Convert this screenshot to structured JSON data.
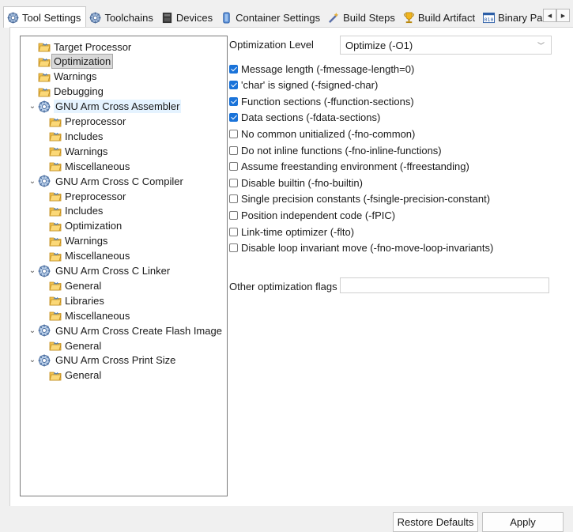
{
  "tabs": [
    {
      "label": "Tool Settings",
      "icon": "gear-icon",
      "active": true
    },
    {
      "label": "Toolchains",
      "icon": "gear-icon",
      "active": false
    },
    {
      "label": "Devices",
      "icon": "chip-icon",
      "active": false
    },
    {
      "label": "Container Settings",
      "icon": "container-icon",
      "active": false
    },
    {
      "label": "Build Steps",
      "icon": "wand-icon",
      "active": false
    },
    {
      "label": "Build Artifact",
      "icon": "trophy-icon",
      "active": false
    },
    {
      "label": "Binary Parsers",
      "icon": "binary-icon",
      "active": false
    }
  ],
  "tree": [
    {
      "label": "Target Processor",
      "level": 1,
      "kind": "folder"
    },
    {
      "label": "Optimization",
      "level": 1,
      "kind": "folder",
      "selected": true
    },
    {
      "label": "Warnings",
      "level": 1,
      "kind": "folder"
    },
    {
      "label": "Debugging",
      "level": 1,
      "kind": "folder"
    },
    {
      "label": "GNU Arm Cross Assembler",
      "level": 0,
      "kind": "tool",
      "expanded": true,
      "hover": true
    },
    {
      "label": "Preprocessor",
      "level": 2,
      "kind": "folder"
    },
    {
      "label": "Includes",
      "level": 2,
      "kind": "folder"
    },
    {
      "label": "Warnings",
      "level": 2,
      "kind": "folder"
    },
    {
      "label": "Miscellaneous",
      "level": 2,
      "kind": "folder"
    },
    {
      "label": "GNU Arm Cross C Compiler",
      "level": 0,
      "kind": "tool",
      "expanded": true
    },
    {
      "label": "Preprocessor",
      "level": 2,
      "kind": "folder"
    },
    {
      "label": "Includes",
      "level": 2,
      "kind": "folder"
    },
    {
      "label": "Optimization",
      "level": 2,
      "kind": "folder"
    },
    {
      "label": "Warnings",
      "level": 2,
      "kind": "folder"
    },
    {
      "label": "Miscellaneous",
      "level": 2,
      "kind": "folder"
    },
    {
      "label": "GNU Arm Cross C Linker",
      "level": 0,
      "kind": "tool",
      "expanded": true
    },
    {
      "label": "General",
      "level": 2,
      "kind": "folder"
    },
    {
      "label": "Libraries",
      "level": 2,
      "kind": "folder"
    },
    {
      "label": "Miscellaneous",
      "level": 2,
      "kind": "folder"
    },
    {
      "label": "GNU Arm Cross Create Flash Image",
      "level": 0,
      "kind": "tool",
      "expanded": true
    },
    {
      "label": "General",
      "level": 2,
      "kind": "folder"
    },
    {
      "label": "GNU Arm Cross Print Size",
      "level": 0,
      "kind": "tool",
      "expanded": true
    },
    {
      "label": "General",
      "level": 2,
      "kind": "folder"
    }
  ],
  "optimization": {
    "level_label": "Optimization Level",
    "level_value": "Optimize (-O1)",
    "options": [
      {
        "label": "Message length (-fmessage-length=0)",
        "checked": true
      },
      {
        "label": "'char' is signed (-fsigned-char)",
        "checked": true
      },
      {
        "label": "Function sections (-ffunction-sections)",
        "checked": true
      },
      {
        "label": "Data sections (-fdata-sections)",
        "checked": true
      },
      {
        "label": "No common unitialized (-fno-common)",
        "checked": false
      },
      {
        "label": "Do not inline functions (-fno-inline-functions)",
        "checked": false
      },
      {
        "label": "Assume freestanding environment (-ffreestanding)",
        "checked": false
      },
      {
        "label": "Disable builtin (-fno-builtin)",
        "checked": false
      },
      {
        "label": "Single precision constants (-fsingle-precision-constant)",
        "checked": false
      },
      {
        "label": "Position independent code (-fPIC)",
        "checked": false
      },
      {
        "label": "Link-time optimizer (-flto)",
        "checked": false
      },
      {
        "label": "Disable loop invariant move (-fno-move-loop-invariants)",
        "checked": false
      }
    ],
    "other_label": "Other optimization flags",
    "other_value": ""
  },
  "buttons": {
    "restore": "Restore Defaults",
    "apply": "Apply"
  },
  "colors": {
    "accent": "#1a73d9",
    "selection": "#d9d9d9",
    "hover": "#e5f3ff"
  }
}
